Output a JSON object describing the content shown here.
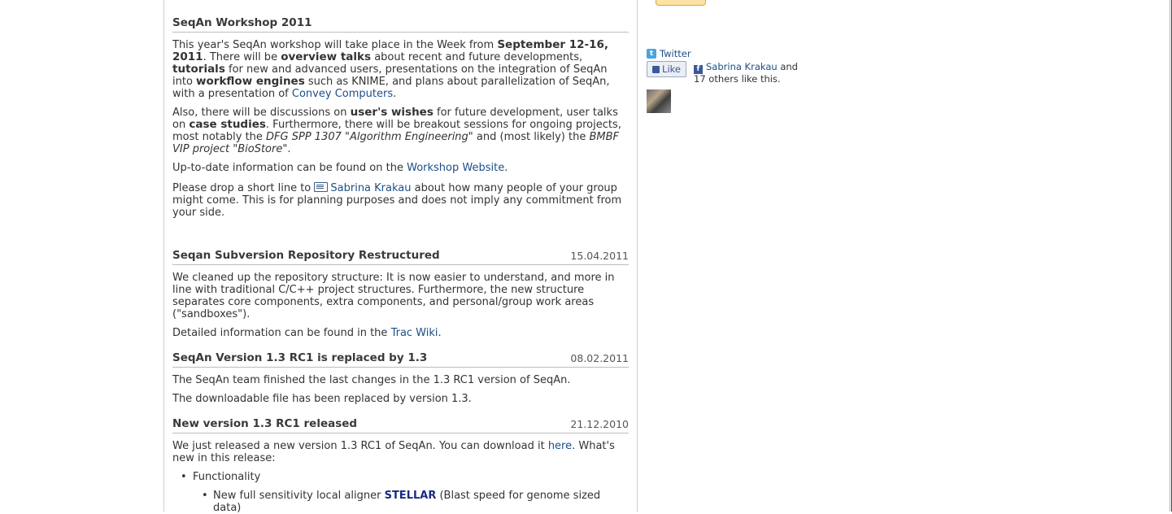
{
  "workshop": {
    "title": "SeqAn Workshop 2011",
    "p1": {
      "t1": "This year's SeqAn workshop will take place in the Week from ",
      "b1": "September 12-16, 2011",
      "t2": ". There will be ",
      "b2": "overview talks",
      "t3": " about recent and future developments, ",
      "b3": "tutorials",
      "t4": " for new and advanced users, presentations on the integration of SeqAn into ",
      "b4": "workflow engines",
      "t5": " such as KNIME, and plans about parallelization of SeqAn, with a presentation of ",
      "link": "Convey Computers",
      "t6": "."
    },
    "p2": {
      "t1": "Also, there will be discussions on ",
      "b1": "user's wishes",
      "t2": " for future development, user talks on ",
      "b2": "case studies",
      "t3": ". Furthermore, there will be breakout sessions for ongoing projects, most notably the ",
      "i1": "DFG SPP 1307 \"Algorithm Engineering\"",
      "t4": " and (most likely) the ",
      "i2": "BMBF VIP project \"BioStore\"",
      "t5": "."
    },
    "p3": {
      "t1": "Up-to-date information can be found on the ",
      "link": "Workshop Website",
      "t2": "."
    },
    "p4": {
      "t1": "Please drop a short line to ",
      "link": "Sabrina Krakau",
      "t2": " about how many people of your group might come. This is for planning purposes and does not imply any commitment from your side."
    }
  },
  "news": [
    {
      "title": "Seqan Subversion Repository Restructured",
      "date": "15.04.2011",
      "p1": "We cleaned up the repository structure: It is now easier to understand, and more in line with traditional C/C++ project structures. Furthermore, the new structure separates core components, extra components, and personal/group work areas (\"sandboxes\").",
      "p2_t1": "Detailed information can be found in the ",
      "p2_link": "Trac Wiki",
      "p2_t2": "."
    },
    {
      "title": "SeqAn Version 1.3 RC1 is replaced by 1.3",
      "date": "08.02.2011",
      "p1": "The SeqAn team finished the last changes in the 1.3 RC1 version of SeqAn.",
      "p2": "The downloadable file has been replaced by version 1.3."
    },
    {
      "title": "New version 1.3 RC1 released",
      "date": "21.12.2010",
      "p1_t1": "We just released a new version 1.3 RC1 of SeqAn. You can download it ",
      "p1_link": "here",
      "p1_t2": ". What's new in this release:",
      "li1": "Functionality",
      "li2_t1": "New full sensitivity local aligner ",
      "li2_link": "STELLAR",
      "li2_t2": " (Blast speed for genome sized data)"
    }
  ],
  "sidebar": {
    "twitter": "Twitter",
    "like": "Like",
    "fb_name": "Sabrina Krakau",
    "fb_and": " and",
    "fb_others": "17 others like this."
  },
  "colors": {
    "link": "#1d4f86",
    "facebook": "#3b5998",
    "twitter": "#4aa3df"
  }
}
